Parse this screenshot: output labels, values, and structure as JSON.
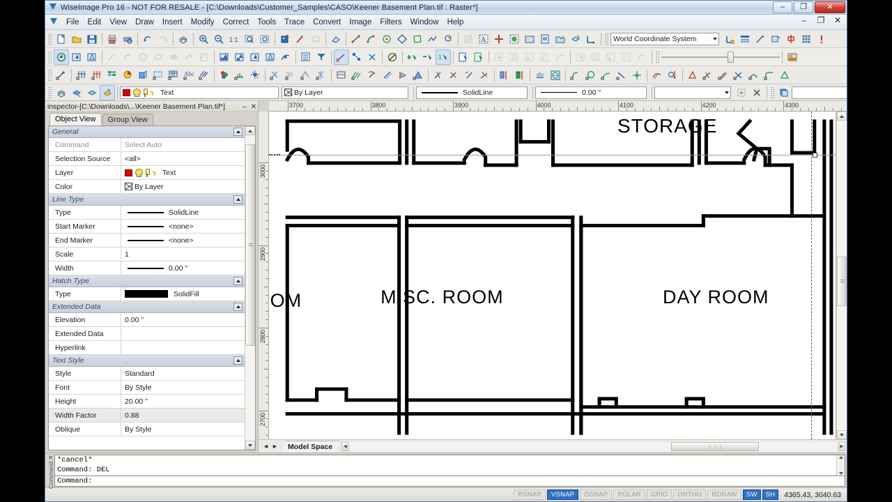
{
  "window": {
    "title": "WiseImage Pro 16 - NOT FOR RESALE - [C:\\Downloads\\Customer_Samples\\CASO\\Keener Basement Plan.tif : Raster*]",
    "minimize": "–",
    "restore": "❐",
    "close": "✕"
  },
  "menu": {
    "items": [
      {
        "label": "File"
      },
      {
        "label": "Edit"
      },
      {
        "label": "View"
      },
      {
        "label": "Draw"
      },
      {
        "label": "Insert"
      },
      {
        "label": "Modify"
      },
      {
        "label": "Correct"
      },
      {
        "label": "Tools"
      },
      {
        "label": "Trace"
      },
      {
        "label": "Convert"
      },
      {
        "label": "Image"
      },
      {
        "label": "Filters"
      },
      {
        "label": "Window"
      },
      {
        "label": "Help"
      }
    ],
    "mdi": {
      "minimize": "–",
      "restore": "❐",
      "close": "✕"
    }
  },
  "coordinate_system": {
    "selected": "World Coordinate System"
  },
  "properties_toolbar": {
    "layer": {
      "name": "Text",
      "color": "#e00000"
    },
    "color": {
      "label": "By Layer"
    },
    "linetype": {
      "label": "SolidLine"
    },
    "lineweight": {
      "label": "0.00 \""
    },
    "style_empty": "",
    "group_empty": ""
  },
  "inspector": {
    "title": "inspector-[C:\\Downloads\\...\\Keener Basement Plan.tif*]",
    "minimize": "–",
    "close": "✕",
    "tabs": [
      {
        "label": "Object View",
        "selected": true
      },
      {
        "label": "Group View",
        "selected": false
      }
    ],
    "sections": [
      {
        "name": "General",
        "rows": [
          {
            "key": "Command",
            "value": "Select Auto",
            "type": "gray"
          },
          {
            "key": "Selection Source",
            "value": "<all>",
            "type": "text"
          },
          {
            "key": "Layer",
            "value": "Text",
            "type": "layer"
          },
          {
            "key": "Color",
            "value": "By Layer",
            "type": "bylayer"
          }
        ]
      },
      {
        "name": "Line Type",
        "rows": [
          {
            "key": "Type",
            "value": "SolidLine",
            "type": "line"
          },
          {
            "key": "Start Marker",
            "value": "<none>",
            "type": "line"
          },
          {
            "key": "End Marker",
            "value": "<none>",
            "type": "line"
          },
          {
            "key": "Scale",
            "value": "1",
            "type": "text"
          },
          {
            "key": "Width",
            "value": "0.00 \"",
            "type": "line"
          }
        ]
      },
      {
        "name": "Hatch Type",
        "rows": [
          {
            "key": "Type",
            "value": "SolidFill",
            "type": "fill"
          }
        ]
      },
      {
        "name": "Extended Data",
        "rows": [
          {
            "key": "Elevation",
            "value": "0.00 \"",
            "type": "text"
          },
          {
            "key": "Extended Data",
            "value": "",
            "type": "text"
          },
          {
            "key": "Hyperlink",
            "value": "",
            "type": "text"
          }
        ]
      },
      {
        "name": "Text Style",
        "rows": [
          {
            "key": "Style",
            "value": "Standard",
            "type": "text"
          },
          {
            "key": "Font",
            "value": "By Style",
            "type": "text"
          },
          {
            "key": "Height",
            "value": "20.00 \"",
            "type": "text"
          },
          {
            "key": "Width Factor",
            "value": "0.88",
            "type": "text",
            "highlight": true
          },
          {
            "key": "Oblique",
            "value": "By Style",
            "type": "text"
          }
        ]
      }
    ]
  },
  "canvas": {
    "ruler_h": {
      "labels": [
        "3700",
        "3800",
        "3900",
        "4000",
        "4100",
        "4200",
        "4300"
      ]
    },
    "ruler_v": {
      "labels": [
        "3000",
        "2900",
        "2800",
        "2700"
      ]
    },
    "room_labels": [
      {
        "text": "STORAGE"
      },
      {
        "text": "OM"
      },
      {
        "text": "MISC. ROOM"
      },
      {
        "text": "DAY ROOM"
      }
    ]
  },
  "model_tabs": {
    "prev": "◄",
    "next": "►",
    "active": "Model Space"
  },
  "command_window": {
    "label": "Command",
    "close": "✕",
    "history": [
      "*cancel*",
      "Command: DEL"
    ],
    "prompt": "Command:"
  },
  "statusbar": {
    "toggles": [
      {
        "label": "RSNAP",
        "on": false
      },
      {
        "label": "VSNAP",
        "on": true
      },
      {
        "label": "OSNAP",
        "on": false
      },
      {
        "label": "POLAR",
        "on": false
      },
      {
        "label": "GRID",
        "on": false
      },
      {
        "label": "ORTHO",
        "on": false
      },
      {
        "label": "RDRAW",
        "on": false
      },
      {
        "label": "SW",
        "on": true
      },
      {
        "label": "SH",
        "on": true
      }
    ],
    "coordinates": "4365.43, 3040.63"
  }
}
